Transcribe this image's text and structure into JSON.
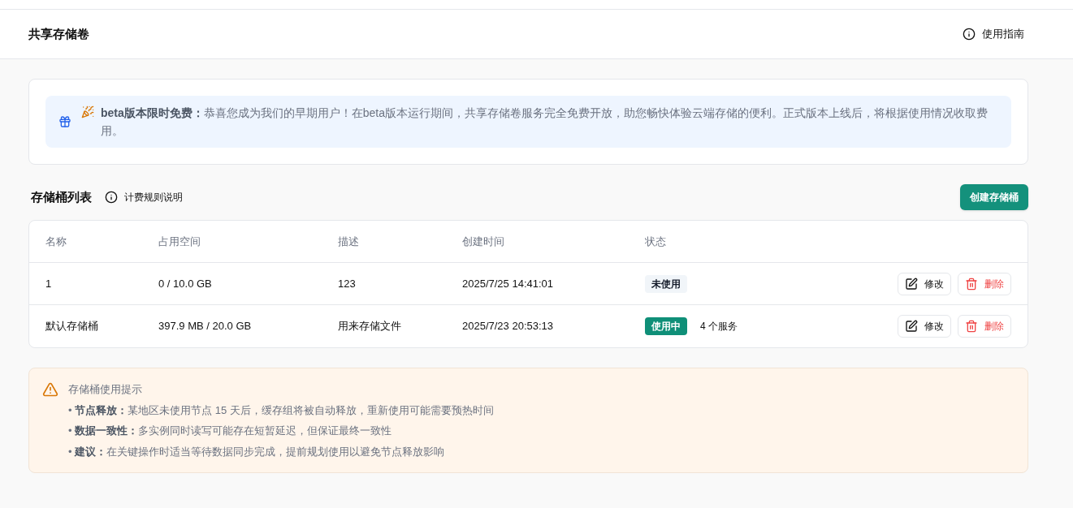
{
  "header": {
    "title": "共享存储卷",
    "guide_link": "使用指南"
  },
  "notice": {
    "text": "**beta版本限时免费：**恭喜您成为我们的早期用户！在beta版本运行期间，共享存储卷服务完全免费开放，助您畅快体验云端存储的便利。正式版本上线后，将根据使用情况收取费用。"
  },
  "bucket_section": {
    "title": "存储桶列表",
    "billing_link": "计费规则说明",
    "create_button": "创建存储桶"
  },
  "table": {
    "columns": [
      "名称",
      "占用空间",
      "描述",
      "创建时间",
      "状态"
    ],
    "rows": [
      {
        "name": "1",
        "usage": "0 / 10.0 GB",
        "description": "123",
        "created": "2025/7/25 14:41:01",
        "status": {
          "kind": "unused",
          "label": "未使用"
        },
        "services": "",
        "edit": "修改",
        "delete": "删除"
      },
      {
        "name": "默认存储桶",
        "usage": "397.9 MB / 20.0 GB",
        "description": "用来存储文件",
        "created": "2025/7/23 20:53:13",
        "status": {
          "kind": "in_use",
          "label": "使用中"
        },
        "services": "4 个服务",
        "edit": "修改",
        "delete": "删除"
      }
    ]
  },
  "tips": {
    "title": "存储桶使用提示",
    "items": [
      "• **节点释放：**某地区未使用节点 15 天后，缓存组将被自动释放，重新使用可能需要预热时间",
      "• **数据一致性：**多实例同时读写可能存在短暂延迟，但保证最终一致性",
      "• **建议：**在关键操作时适当等待数据同步完成，提前规划使用以避免节点释放影响"
    ]
  }
}
